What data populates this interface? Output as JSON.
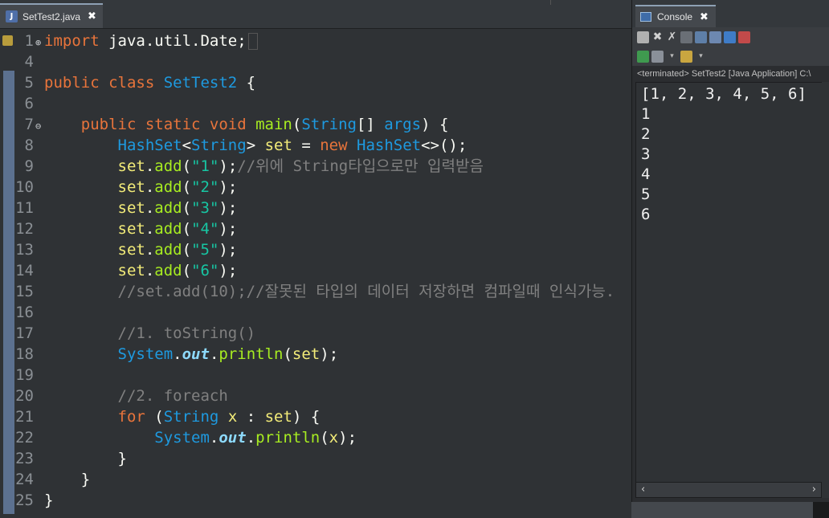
{
  "editor": {
    "tab": {
      "title": "SetTest2.java",
      "close": "✖",
      "icon": "java-file-icon"
    },
    "lines": [
      {
        "n": "1",
        "fold": "⊕",
        "marker": true,
        "tokens": [
          {
            "t": "import ",
            "c": "kw"
          },
          {
            "t": "java.util.Date;",
            "c": "pl"
          }
        ]
      },
      {
        "n": "4",
        "tokens": []
      },
      {
        "n": "5",
        "tokens": [
          {
            "t": "public class ",
            "c": "kw"
          },
          {
            "t": "SetTest2",
            "c": "ty"
          },
          {
            "t": " {",
            "c": "pl"
          }
        ]
      },
      {
        "n": "6",
        "tokens": []
      },
      {
        "n": "7",
        "fold": "⊖",
        "tokens": [
          {
            "t": "    public static void ",
            "c": "kw"
          },
          {
            "t": "main",
            "c": "fn"
          },
          {
            "t": "(",
            "c": "pl"
          },
          {
            "t": "String",
            "c": "ty"
          },
          {
            "t": "[] ",
            "c": "pl"
          },
          {
            "t": "args",
            "c": "ty"
          },
          {
            "t": ") {",
            "c": "pl"
          }
        ]
      },
      {
        "n": "8",
        "tokens": [
          {
            "t": "        HashSet",
            "c": "ty"
          },
          {
            "t": "<",
            "c": "pl"
          },
          {
            "t": "String",
            "c": "ty"
          },
          {
            "t": "> ",
            "c": "pl"
          },
          {
            "t": "set",
            "c": "va"
          },
          {
            "t": " = ",
            "c": "pl"
          },
          {
            "t": "new ",
            "c": "kw"
          },
          {
            "t": "HashSet",
            "c": "ty"
          },
          {
            "t": "<>();",
            "c": "pl"
          }
        ]
      },
      {
        "n": "9",
        "tokens": [
          {
            "t": "        set",
            "c": "va"
          },
          {
            "t": ".",
            "c": "pl"
          },
          {
            "t": "add",
            "c": "fn"
          },
          {
            "t": "(",
            "c": "pl"
          },
          {
            "t": "\"1\"",
            "c": "st"
          },
          {
            "t": ");",
            "c": "pl"
          },
          {
            "t": "//위에 String타입으로만 입력받음",
            "c": "cm"
          }
        ]
      },
      {
        "n": "10",
        "tokens": [
          {
            "t": "        set",
            "c": "va"
          },
          {
            "t": ".",
            "c": "pl"
          },
          {
            "t": "add",
            "c": "fn"
          },
          {
            "t": "(",
            "c": "pl"
          },
          {
            "t": "\"2\"",
            "c": "st"
          },
          {
            "t": ");",
            "c": "pl"
          }
        ]
      },
      {
        "n": "11",
        "tokens": [
          {
            "t": "        set",
            "c": "va"
          },
          {
            "t": ".",
            "c": "pl"
          },
          {
            "t": "add",
            "c": "fn"
          },
          {
            "t": "(",
            "c": "pl"
          },
          {
            "t": "\"3\"",
            "c": "st"
          },
          {
            "t": ");",
            "c": "pl"
          }
        ]
      },
      {
        "n": "12",
        "tokens": [
          {
            "t": "        set",
            "c": "va"
          },
          {
            "t": ".",
            "c": "pl"
          },
          {
            "t": "add",
            "c": "fn"
          },
          {
            "t": "(",
            "c": "pl"
          },
          {
            "t": "\"4\"",
            "c": "st"
          },
          {
            "t": ");",
            "c": "pl"
          }
        ]
      },
      {
        "n": "13",
        "tokens": [
          {
            "t": "        set",
            "c": "va"
          },
          {
            "t": ".",
            "c": "pl"
          },
          {
            "t": "add",
            "c": "fn"
          },
          {
            "t": "(",
            "c": "pl"
          },
          {
            "t": "\"5\"",
            "c": "st"
          },
          {
            "t": ");",
            "c": "pl"
          }
        ]
      },
      {
        "n": "14",
        "tokens": [
          {
            "t": "        set",
            "c": "va"
          },
          {
            "t": ".",
            "c": "pl"
          },
          {
            "t": "add",
            "c": "fn"
          },
          {
            "t": "(",
            "c": "pl"
          },
          {
            "t": "\"6\"",
            "c": "st"
          },
          {
            "t": ");",
            "c": "pl"
          }
        ]
      },
      {
        "n": "15",
        "tokens": [
          {
            "t": "        //set.add(10);//잘못된 타입의 데이터 저장하면 컴파일때 인식가능.",
            "c": "cm"
          }
        ]
      },
      {
        "n": "16",
        "tokens": []
      },
      {
        "n": "17",
        "tokens": [
          {
            "t": "        //1. toString()",
            "c": "cm"
          }
        ]
      },
      {
        "n": "18",
        "tokens": [
          {
            "t": "        System",
            "c": "ty"
          },
          {
            "t": ".",
            "c": "pl"
          },
          {
            "t": "out",
            "c": "fd"
          },
          {
            "t": ".",
            "c": "pl"
          },
          {
            "t": "println",
            "c": "fn"
          },
          {
            "t": "(",
            "c": "pl"
          },
          {
            "t": "set",
            "c": "va"
          },
          {
            "t": ");",
            "c": "pl"
          }
        ]
      },
      {
        "n": "19",
        "tokens": []
      },
      {
        "n": "20",
        "tokens": [
          {
            "t": "        //2. foreach",
            "c": "cm"
          }
        ]
      },
      {
        "n": "21",
        "tokens": [
          {
            "t": "        for ",
            "c": "kw"
          },
          {
            "t": "(",
            "c": "pl"
          },
          {
            "t": "String",
            "c": "ty"
          },
          {
            "t": " ",
            "c": "pl"
          },
          {
            "t": "x",
            "c": "va"
          },
          {
            "t": " : ",
            "c": "pl"
          },
          {
            "t": "set",
            "c": "va"
          },
          {
            "t": ") {",
            "c": "pl"
          }
        ]
      },
      {
        "n": "22",
        "tokens": [
          {
            "t": "            System",
            "c": "ty"
          },
          {
            "t": ".",
            "c": "pl"
          },
          {
            "t": "out",
            "c": "fd"
          },
          {
            "t": ".",
            "c": "pl"
          },
          {
            "t": "println",
            "c": "fn"
          },
          {
            "t": "(",
            "c": "pl"
          },
          {
            "t": "x",
            "c": "va"
          },
          {
            "t": ");",
            "c": "pl"
          }
        ]
      },
      {
        "n": "23",
        "tokens": [
          {
            "t": "        }",
            "c": "pl"
          }
        ]
      },
      {
        "n": "24",
        "tokens": [
          {
            "t": "    }",
            "c": "pl"
          }
        ]
      },
      {
        "n": "25",
        "tokens": [
          {
            "t": "}",
            "c": "pl"
          }
        ]
      }
    ]
  },
  "console": {
    "tab": {
      "title": "Console",
      "close": "✖",
      "icon": "console-icon"
    },
    "status": "<terminated> SetTest2 [Java Application] C:\\",
    "output": [
      "[1, 2, 3, 4, 5, 6]",
      "1",
      "2",
      "3",
      "4",
      "5",
      "6"
    ],
    "scroll_left": "‹",
    "scroll_right": "›",
    "toolbar1": [
      "terminate-icon",
      "remove-launch-icon",
      "remove-all-icon",
      "clear-console-icon",
      "scroll-lock-icon",
      "word-wrap-icon",
      "pin-console-icon",
      "display-selected-icon"
    ],
    "toolbar2": [
      "open-console-icon",
      "display-console-icon",
      "new-console-icon"
    ]
  },
  "colors": {
    "keyword": "#e8743b",
    "type": "#1e9ae0",
    "method": "#a7ec21",
    "string": "#17c6a3",
    "comment": "#808080",
    "plain": "#f9faf4",
    "variable": "#f3ec79",
    "field": "#8dd9fb"
  }
}
